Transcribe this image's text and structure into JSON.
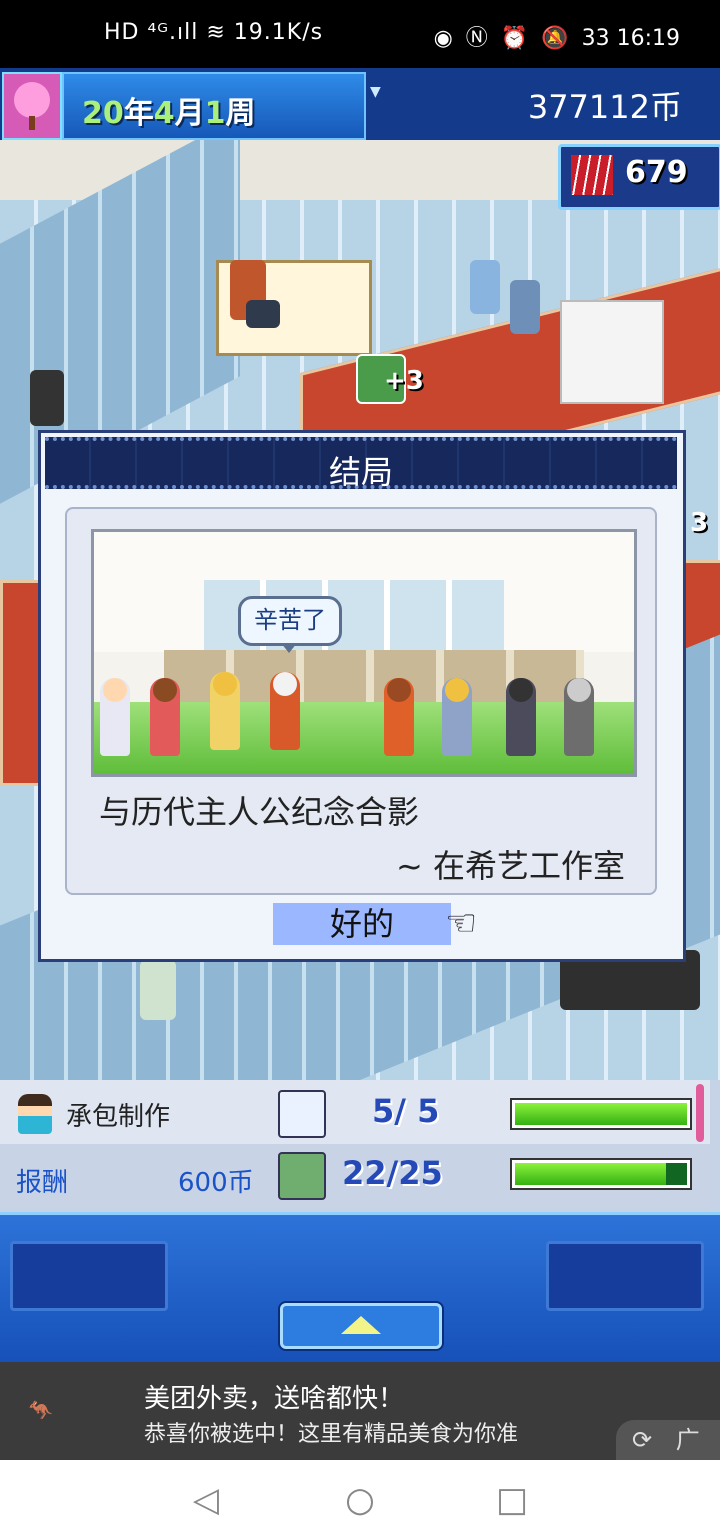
{
  "status_bar": {
    "left": "HD ⁴ᴳ.ıll ≋ 19.1K/s",
    "right": "33 16:19"
  },
  "header": {
    "date_year": "20",
    "date_year_unit": "年",
    "date_month": "4",
    "date_month_unit": "月",
    "date_week": "1",
    "date_week_unit": "周",
    "money": "377112币",
    "badge_value": "679"
  },
  "scene": {
    "plus3_a": "+3",
    "plus3_b": "3"
  },
  "dialog": {
    "title": "结局",
    "bubble": "辛苦了",
    "caption_line1": "与历代主人公纪念合影",
    "caption_line2": "~ 在希艺工作室",
    "ok_label": "好的",
    "pointer_icon": "pointing-hand-icon"
  },
  "info_panel": {
    "job_label": "承包制作",
    "reward_label": "报酬",
    "reward_value": "600币",
    "stat1": "5/  5",
    "stat1_fill": 1.0,
    "stat2": "22/25",
    "stat2_fill": 0.88
  },
  "ad": {
    "line1": "美团外卖，送啥都快！",
    "line2": "恭喜你被选中！这里有精品美食为你准",
    "tag": "广告"
  },
  "nav": {
    "back": "◁",
    "home": "○",
    "recents": "□"
  }
}
